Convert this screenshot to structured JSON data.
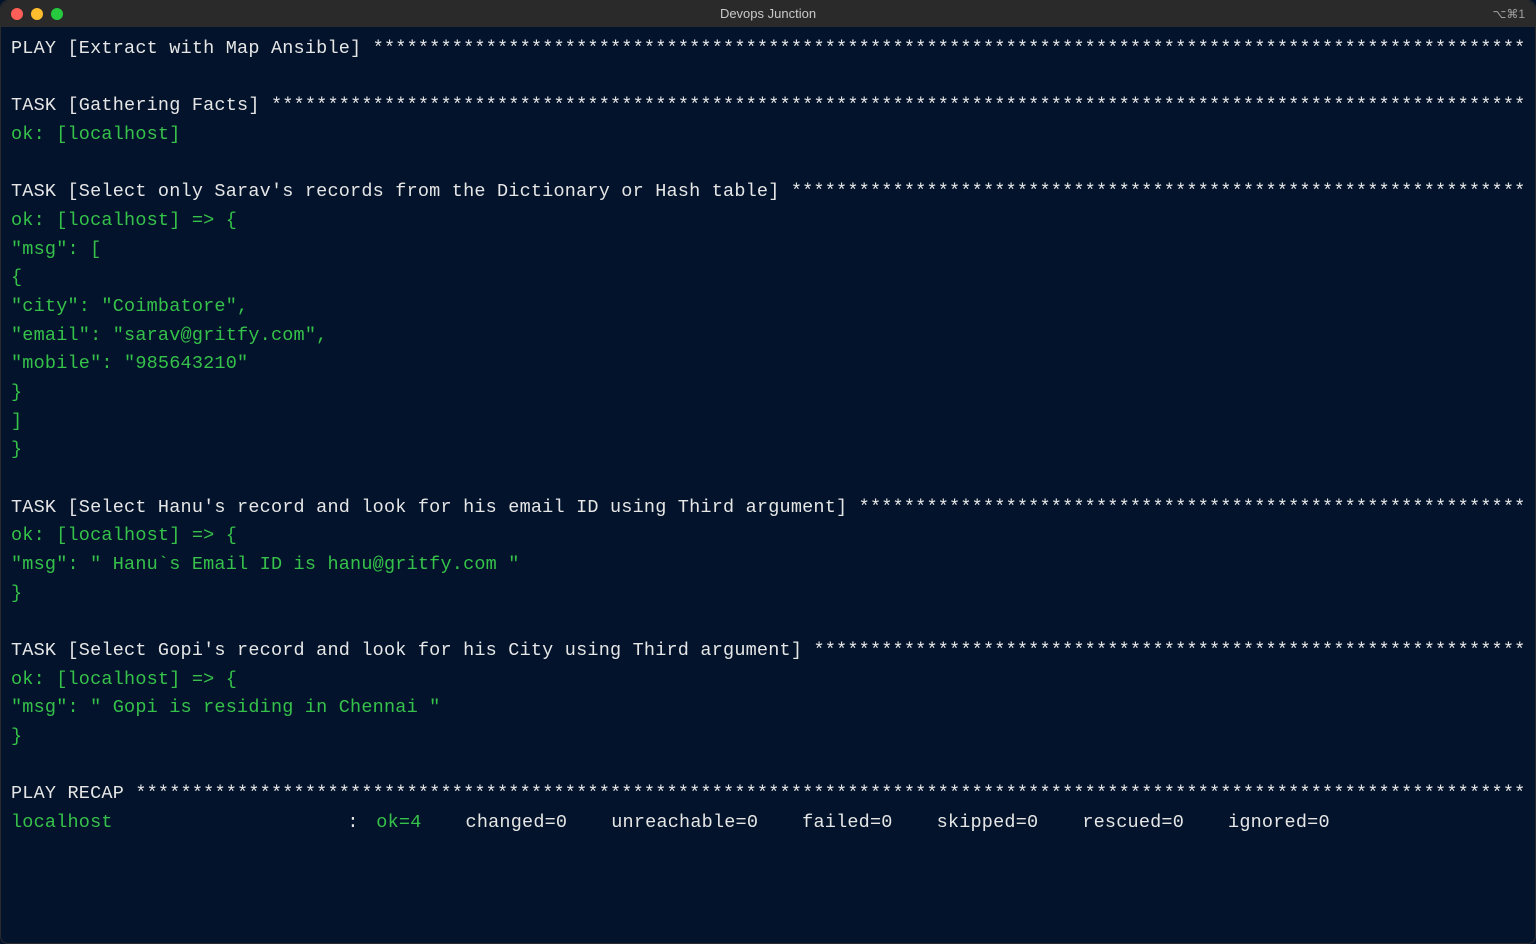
{
  "window": {
    "title": "Devops Junction",
    "right_indicator": "⌥⌘1"
  },
  "colors": {
    "bg": "#02132b",
    "fg": "#e6e6e6",
    "green": "#36c24a",
    "cyan": "#3ec9d6"
  },
  "ansible": {
    "play_header": "PLAY [Extract with Map Ansible]",
    "tasks": [
      {
        "name": "Gathering Facts",
        "status_line": "ok: [localhost]"
      },
      {
        "name": "Select only Sarav's records from the Dictionary or Hash table",
        "ok_prefix": "ok: [localhost] => {",
        "body": [
          "    \"msg\": [",
          "        {",
          "            \"city\": \"Coimbatore\",",
          "            \"email\": \"sarav@gritfy.com\",",
          "            \"mobile\": \"985643210\"",
          "        }",
          "    ]",
          "}"
        ]
      },
      {
        "name": "Select Hanu's record and look for his email ID using Third argument",
        "ok_prefix": "ok: [localhost] => {",
        "body": [
          "    \"msg\": \" Hanu`s Email ID is hanu@gritfy.com \"",
          "}"
        ]
      },
      {
        "name": "Select Gopi's record and look for his City using Third argument",
        "ok_prefix": "ok: [localhost] => {",
        "body": [
          "    \"msg\": \" Gopi is residing in Chennai \"",
          "}"
        ]
      }
    ],
    "recap_header": "PLAY RECAP",
    "recap": {
      "host": "localhost",
      "colon": ":",
      "ok": "ok=4",
      "changed": "changed=0",
      "unreachable": "unreachable=0",
      "failed": "failed=0",
      "skipped": "skipped=0",
      "rescued": "rescued=0",
      "ignored": "ignored=0"
    }
  }
}
